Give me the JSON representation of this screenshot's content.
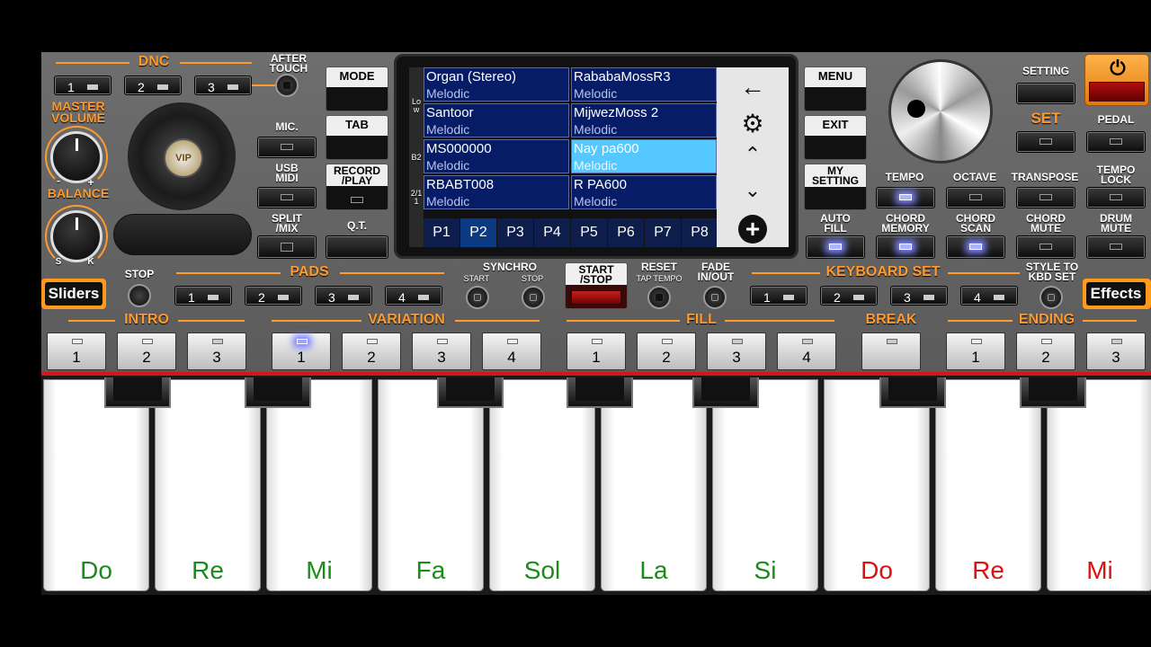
{
  "left": {
    "dnc": "DNC",
    "dnc_buttons": [
      "1",
      "2",
      "3"
    ],
    "after_touch": "AFTER\nTOUCH",
    "master_volume": "MASTER\nVOLUME",
    "balance": "BALANCE",
    "balance_minus": "-",
    "balance_plus": "+",
    "balance_s": "S",
    "balance_k": "K",
    "logo": "VIP",
    "mic": "MIC.",
    "usb_midi": "USB\nMIDI",
    "split_mix": "SPLIT\n/MIX"
  },
  "mid_left": {
    "mode": "MODE",
    "tab": "TAB",
    "record_play": "RECORD\n/PLAY",
    "qt": "Q.T."
  },
  "screen": {
    "side_label_1": "Low",
    "side_label_2": "B2",
    "side_label_3": "2/11",
    "cells": [
      {
        "name": "Organ (Stereo)",
        "cat": "Melodic"
      },
      {
        "name": "RababaMossR3",
        "cat": "Melodic"
      },
      {
        "name": "Santoor",
        "cat": "Melodic"
      },
      {
        "name": "MijwezMoss 2",
        "cat": "Melodic"
      },
      {
        "name": "MS000000",
        "cat": "Melodic"
      },
      {
        "name": "Nay pa600",
        "cat": "Melodic"
      },
      {
        "name": "RBABT008",
        "cat": "Melodic"
      },
      {
        "name": "R PA600",
        "cat": "Melodic"
      }
    ],
    "pages": [
      "P1",
      "P2",
      "P3",
      "P4",
      "P5",
      "P6",
      "P7",
      "P8"
    ]
  },
  "mid_right": {
    "menu": "MENU",
    "exit": "EXIT",
    "my_setting": "MY\nSETTING",
    "auto_fill": "AUTO\nFILL"
  },
  "right": {
    "setting": "SETTING",
    "set": "SET",
    "pedal": "PEDAL",
    "tempo": "TEMPO",
    "octave": "OCTAVE",
    "transpose": "TRANSPOSE",
    "tempo_lock": "TEMPO\nLOCK",
    "chord_memory": "CHORD\nMEMORY",
    "chord_scan": "CHORD\nSCAN",
    "chord_mute": "CHORD\nMUTE",
    "drum_mute": "DRUM\nMUTE"
  },
  "row2": {
    "sliders": "Sliders",
    "stop": "STOP",
    "pads": "PADS",
    "pads_buttons": [
      "1",
      "2",
      "3",
      "4"
    ],
    "synchro": "SYNCHRO",
    "sync_start": "START",
    "sync_stop": "STOP",
    "start_stop": "START\n/STOP",
    "reset": "RESET",
    "tap_tempo": "TAP TEMPO",
    "fade": "FADE\nIN/OUT",
    "keyboard_set": "KEYBOARD SET",
    "kbd_buttons": [
      "1",
      "2",
      "3",
      "4"
    ],
    "style_to_kbd": "STYLE TO\nKBD SET",
    "effects": "Effects"
  },
  "row3": {
    "intro": "INTRO",
    "intro_buttons": [
      "1",
      "2",
      "3"
    ],
    "variation": "VARIATION",
    "variation_buttons": [
      "1",
      "2",
      "3",
      "4"
    ],
    "fill": "FILL",
    "fill_buttons": [
      "1",
      "2",
      "3",
      "4"
    ],
    "break_label": "BREAK",
    "ending": "ENDING",
    "ending_buttons": [
      "1",
      "2",
      "3"
    ]
  },
  "keys": [
    {
      "label": "Do",
      "color": "#1a8c1a"
    },
    {
      "label": "Re",
      "color": "#1a8c1a"
    },
    {
      "label": "Mi",
      "color": "#1a8c1a"
    },
    {
      "label": "Fa",
      "color": "#1a8c1a"
    },
    {
      "label": "Sol",
      "color": "#1a8c1a"
    },
    {
      "label": "La",
      "color": "#1a8c1a"
    },
    {
      "label": "Si",
      "color": "#1a8c1a"
    },
    {
      "label": "Do",
      "color": "#e01010"
    },
    {
      "label": "Re",
      "color": "#e01010"
    },
    {
      "label": "Mi",
      "color": "#e01010"
    }
  ],
  "colors": {
    "accent": "#ff9a2e",
    "selected_cell": "#55c8ff",
    "power": "#ff9a1a"
  }
}
